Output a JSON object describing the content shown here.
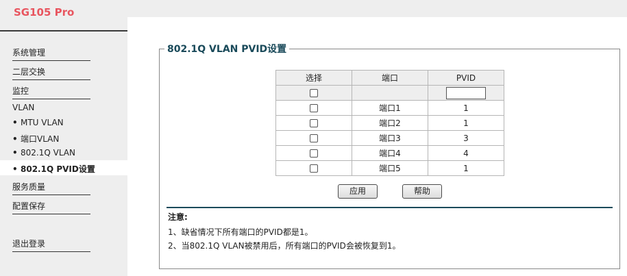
{
  "header": {
    "brand": "SG105 Pro"
  },
  "sidebar": {
    "items": [
      {
        "label": "系统管理"
      },
      {
        "label": "二层交换"
      },
      {
        "label": "监控"
      },
      {
        "label": "VLAN"
      }
    ],
    "vlan_sub": [
      {
        "label": "MTU VLAN"
      },
      {
        "label": "端口VLAN"
      },
      {
        "label": "802.1Q VLAN"
      },
      {
        "label": "802.1Q PVID设置",
        "active": true
      }
    ],
    "items_after": [
      {
        "label": "服务质量"
      },
      {
        "label": "配置保存"
      }
    ],
    "logout": "退出登录",
    "bullet": "•"
  },
  "main": {
    "title": "802.1Q VLAN PVID设置",
    "table": {
      "headers": [
        "选择",
        "端口",
        "PVID"
      ],
      "rows": [
        {
          "port": "端口1",
          "pvid": "1"
        },
        {
          "port": "端口2",
          "pvid": "1"
        },
        {
          "port": "端口3",
          "pvid": "3"
        },
        {
          "port": "端口4",
          "pvid": "4"
        },
        {
          "port": "端口5",
          "pvid": "1"
        }
      ],
      "batch_pvid_value": ""
    },
    "apply_label": "应用",
    "help_label": "帮助",
    "note": {
      "title": "注意:",
      "lines": [
        "1、缺省情况下所有端口的PVID都是1。",
        "2、当802.1Q VLAN被禁用后，所有端口的PVID会被恢复到1。"
      ]
    }
  }
}
